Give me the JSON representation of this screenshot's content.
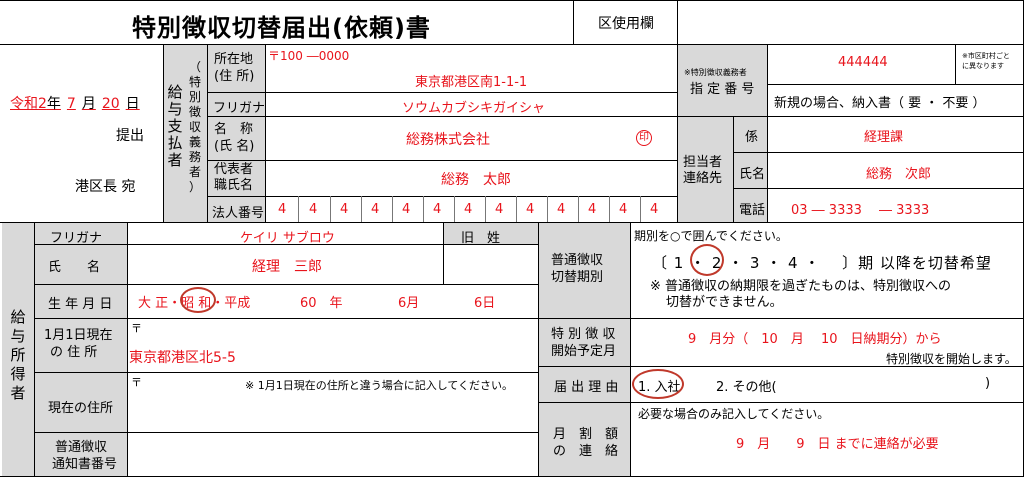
{
  "header": {
    "title": "特別徴収切替届出(依頼)書",
    "office_use_label": "区使用欄"
  },
  "submission": {
    "date": {
      "era": "令和2",
      "year_suffix": "年",
      "month": "7",
      "month_suffix": "月",
      "day": "20",
      "day_suffix": "日"
    },
    "submit_label": "提出",
    "addressee": "港区長 宛"
  },
  "payer": {
    "section_label": [
      "給",
      "与",
      "支",
      "払",
      "者"
    ],
    "sub_label": [
      "（",
      "特",
      "別",
      "徴",
      "収",
      "義",
      "務",
      "者",
      "）"
    ],
    "address_label": [
      "所在地",
      "(住 所)"
    ],
    "postal": "〒100 ―0000",
    "address": "東京都港区南1-1-1",
    "furigana_label": "フリガナ",
    "furigana": "ソウムカブシキガイシャ",
    "name_label": [
      "名　称",
      "(氏 名)"
    ],
    "name": "総務株式会社",
    "seal": "印",
    "rep_label": [
      "代表者",
      "職氏名"
    ],
    "rep_name": "総務　太郎",
    "corp_no_label": "法人番号",
    "corp_no_digits": [
      "4",
      "4",
      "4",
      "4",
      "4",
      "4",
      "4",
      "4",
      "4",
      "4",
      "4",
      "4",
      "4"
    ]
  },
  "designated": {
    "label_small": "※特別徴収義務者",
    "label_main": "指 定 番 号",
    "number": "444444",
    "note": [
      "※市区町村ごと",
      "に異なります"
    ],
    "new_case_text": "新規の場合、納入書（ 要 ・ 不要 ）"
  },
  "contact": {
    "label": [
      "担当者",
      "連絡先"
    ],
    "dept_label": "係",
    "dept": "経理課",
    "person_label": "氏名",
    "person": "総務　次郎",
    "phone_label": "電話",
    "phone": "03 ― 3333　 ― 3333"
  },
  "earner": {
    "section_label": [
      "給",
      "与",
      "所",
      "得",
      "者"
    ],
    "furigana_label": "フリガナ",
    "furigana": "ケイリ サブロウ",
    "former_label": "旧　姓",
    "name_label": "氏　　名",
    "name": "経理　三郎",
    "birth_label": "生 年 月 日",
    "birth_eras": "大 正・昭 和・平成",
    "birth_year": "60　年",
    "birth_month": "6月",
    "birth_day": "6日",
    "jan1_label": [
      "1月1日現在",
      "の 住 所"
    ],
    "jan1_postal": "〒",
    "jan1_address": "東京都港区北5-5",
    "current_label": "現在の住所",
    "current_postal": "〒",
    "current_note": "※ 1月1日現在の住所と違う場合に記入してください。",
    "notice_no_label": [
      "普通徴収",
      "通知書番号"
    ]
  },
  "switch": {
    "period_label": [
      "普通徴収",
      "切替期別"
    ],
    "period_instruction": "期別を○で囲んでください。",
    "period_options": "〔 1 ・ 2 ・ 3 ・ 4 ・　 〕期 以降を切替希望",
    "period_note": [
      "※ 普通徴収の納期限を過ぎたものは、特別徴収への",
      "切替ができません。"
    ],
    "start_label": [
      "特 別 徴 収",
      "開始予定月"
    ],
    "start_text": "9　月分（　10　月　 10　日納期分）から",
    "start_note": "特別徴収を開始します。",
    "reason_label": "届 出 理 由",
    "reason_1": "1. 入社",
    "reason_2": "2. その他(",
    "reason_close": ")",
    "monthly_label": [
      "月　割　額",
      "の　連　絡"
    ],
    "monthly_instruction": "必要な場合のみ記入してください。",
    "monthly_text": "9　月　　9　日 までに連絡が必要"
  }
}
